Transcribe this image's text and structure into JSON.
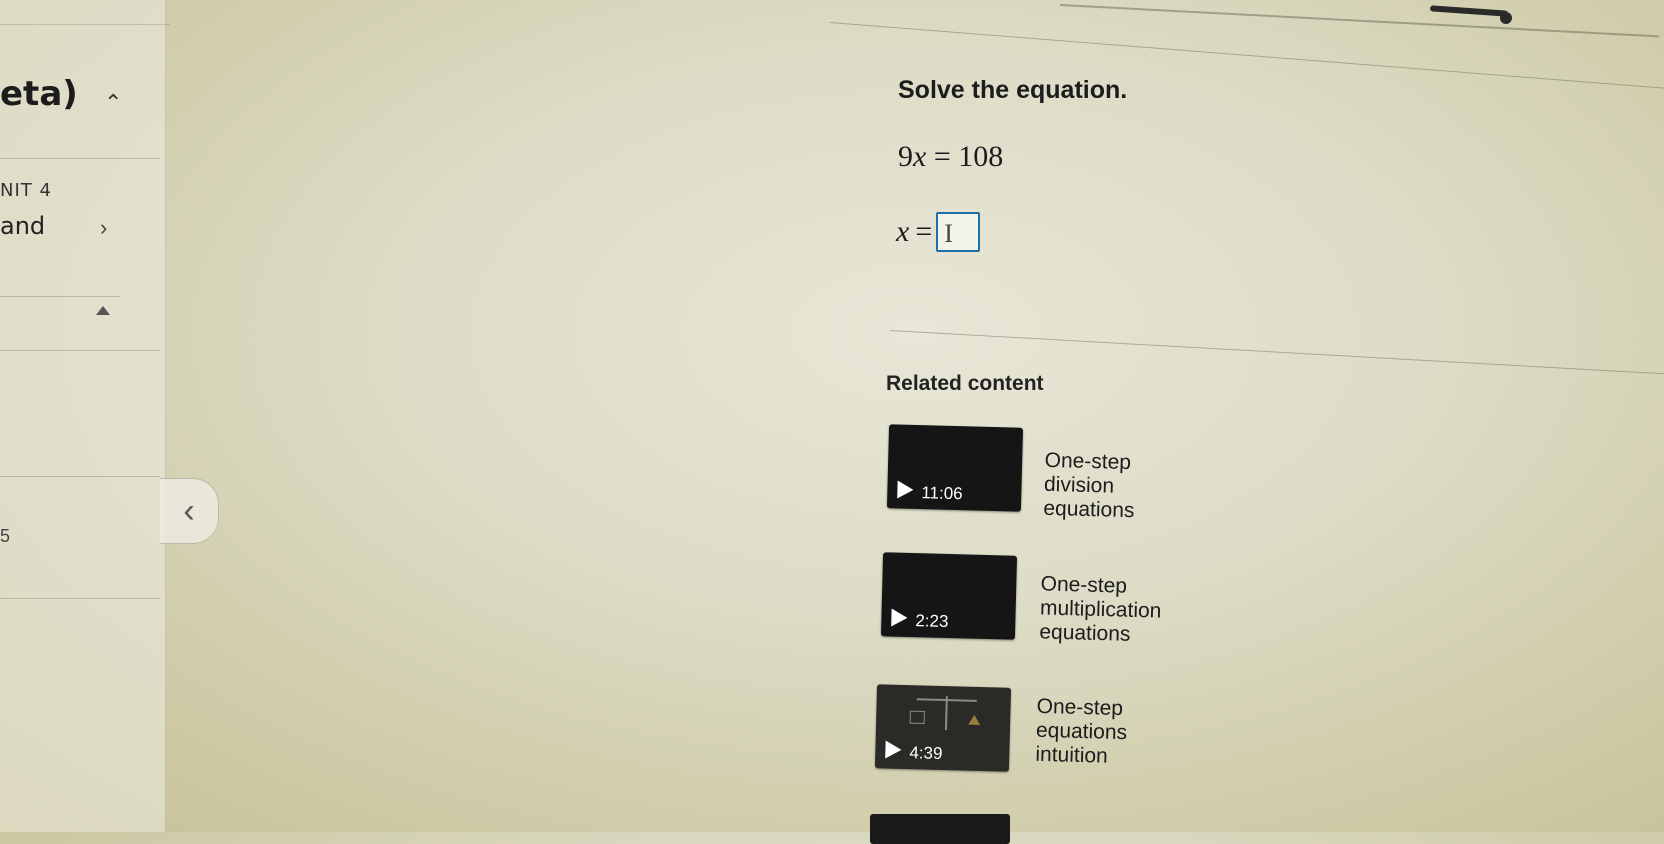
{
  "sidebar": {
    "course_title": "eta)",
    "unit_label": "NIT 4",
    "unit_name": "and",
    "extra_mark": "5"
  },
  "exercise": {
    "prompt": "Solve the equation.",
    "equation": {
      "coef": "9",
      "var": "x",
      "op": " = ",
      "rhs": "108"
    },
    "answer_prefix_var": "x",
    "answer_prefix_op": "=",
    "answer_value": "I"
  },
  "related": {
    "heading": "Related content",
    "videos": [
      {
        "title": "One-step division equations",
        "duration": "11:06"
      },
      {
        "title": "One-step multiplication equations",
        "duration": "2:23"
      },
      {
        "title": "One-step equations intuition",
        "duration": "4:39"
      }
    ]
  },
  "progress": {
    "fraction": 0.8
  },
  "icons": [
    "chevron-up-icon",
    "chevron-right-icon",
    "triangle-up-icon",
    "chevron-left-icon",
    "play-icon"
  ],
  "colors": {
    "answer_border": "#1d6fb0",
    "thumb_bg": "#151515"
  }
}
